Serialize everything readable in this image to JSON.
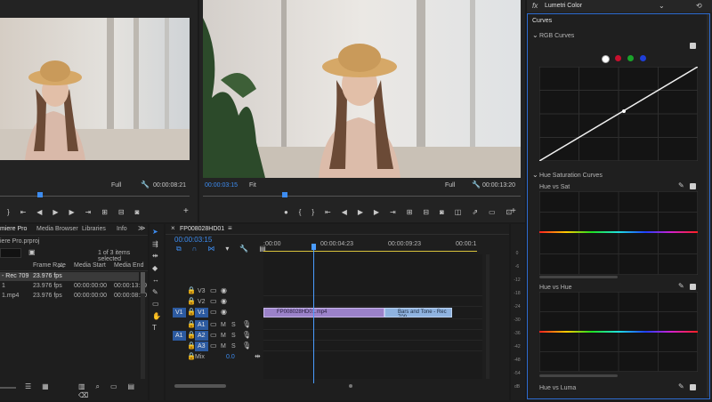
{
  "source_monitor": {
    "dropdown": "Full",
    "timecode": "00:00:08:21"
  },
  "program_monitor": {
    "timecode_current": "00:00:03:15",
    "fit": "Fit",
    "quality": "Full",
    "timecode_duration": "00:00:13:20"
  },
  "project": {
    "tabs": [
      "miere Pro",
      "Media Browser",
      "Libraries",
      "Info"
    ],
    "file": "iere Pro.prproj",
    "selected_text": "1 of 3 items selected",
    "columns": [
      "Frame Rate",
      "Media Start",
      "Media End"
    ],
    "rows": [
      {
        "name": "- Rec 709",
        "rate": "23.976 fps",
        "start": "",
        "end": ""
      },
      {
        "name": "1",
        "rate": "23.976 fps",
        "start": "00:00:00:00",
        "end": "00:00:13:19"
      },
      {
        "name": "1.mp4",
        "rate": "23.976 fps",
        "start": "00:00:00:00",
        "end": "00:00:08:20"
      }
    ]
  },
  "timeline": {
    "seq_name": "FP008028HD01",
    "timecode": "00:00:03:15",
    "ruler": [
      ":00:00",
      "00:00:04:23",
      "00:00:09:23",
      "00:00:1"
    ],
    "tracks": [
      "V3",
      "V2",
      "V1",
      "A1",
      "A2",
      "A3"
    ],
    "source_patch": [
      "V1",
      "A1"
    ],
    "mix_label": "Mix",
    "mix_value": "0.0",
    "clip1": "FP008028HD01.mp4",
    "clip2": "Bars and Tone - Rec 709"
  },
  "meter_scale": [
    "0",
    "-6",
    "-12",
    "-18",
    "-24",
    "-30",
    "-36",
    "-42",
    "-48",
    "-54",
    "dB"
  ],
  "lumetri": {
    "panel_title": "Lumetri Color",
    "section": "Curves",
    "rgb_curves": "RGB Curves",
    "hue_sat_curves": "Hue Saturation Curves",
    "hue_vs_sat": "Hue vs Sat",
    "hue_vs_hue": "Hue vs Hue",
    "hue_vs_luma": "Hue vs Luma"
  },
  "colors": {
    "accent": "#3d8cf0",
    "clip_purple": "#9b82c9",
    "clip_blue": "#8fb3e0",
    "playhead": "#4a9cff"
  }
}
